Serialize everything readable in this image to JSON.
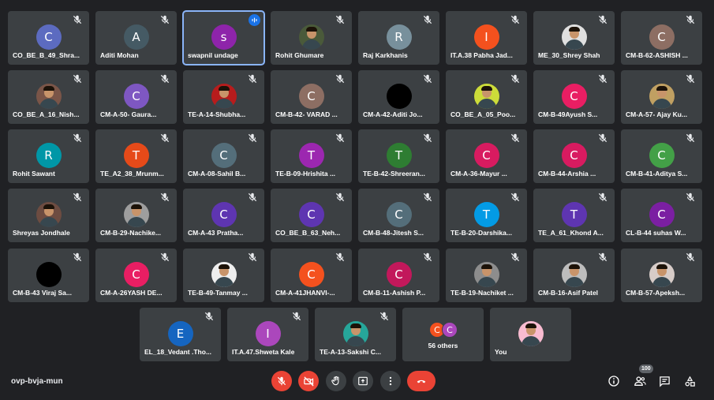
{
  "tiles": [
    {
      "name": "CO_BE_B_49_Shra...",
      "avatar": "C",
      "color": "#5c6bc0"
    },
    {
      "name": "Aditi Mohan",
      "avatar": "A",
      "color": "#455a64"
    },
    {
      "name": "swapnil undage",
      "avatar": "s",
      "color": "#8e24aa",
      "active": true
    },
    {
      "name": "Rohit Ghumare",
      "photo": true,
      "color": "#4a5a3a"
    },
    {
      "name": "Raj Karkhanis",
      "avatar": "R",
      "color": "#78909c"
    },
    {
      "name": "IT.A.38 Pabha Jad...",
      "avatar": "I",
      "color": "#f4511e"
    },
    {
      "name": "ME_30_Shrey Shah",
      "photo": true,
      "color": "#e0e0e0"
    },
    {
      "name": "CM-B-62-ASHISH ...",
      "avatar": "C",
      "color": "#8d6e63"
    },
    {
      "name": "CO_BE_A_16_Nish...",
      "photo": true,
      "color": "#7a5548"
    },
    {
      "name": "CM-A-50- Gaura...",
      "avatar": "C",
      "color": "#7e57c2"
    },
    {
      "name": "TE-A-14-Shubha...",
      "photo": true,
      "color": "#b71c1c"
    },
    {
      "name": "CM-B-42- VARAD ...",
      "avatar": "C",
      "color": "#8d6e63"
    },
    {
      "name": "CM-A-42-Aditi Jo...",
      "avatar": "",
      "color": "#000000"
    },
    {
      "name": "CO_BE_A_05_Poo...",
      "photo": true,
      "color": "#cddc39"
    },
    {
      "name": "CM-B-49Ayush S...",
      "avatar": "C",
      "color": "#e91e63"
    },
    {
      "name": "CM-A-57- Ajay Ku...",
      "photo": true,
      "color": "#c0a062"
    },
    {
      "name": "Rohit Sawant",
      "avatar": "R",
      "color": "#0097a7"
    },
    {
      "name": "TE_A2_38_Mrunm...",
      "avatar": "T",
      "color": "#e64a19"
    },
    {
      "name": "CM-A-08-Sahil B...",
      "avatar": "C",
      "color": "#546e7a"
    },
    {
      "name": "TE-B-09-Hrishita ...",
      "avatar": "T",
      "color": "#9c27b0"
    },
    {
      "name": "TE-B-42-Shreeran...",
      "avatar": "T",
      "color": "#2e7d32"
    },
    {
      "name": "CM-A-36-Mayur ...",
      "avatar": "C",
      "color": "#d81b60"
    },
    {
      "name": "CM-B-44-Arshia ...",
      "avatar": "C",
      "color": "#d81b60"
    },
    {
      "name": "CM-B-41-Aditya S...",
      "avatar": "C",
      "color": "#43a047"
    },
    {
      "name": "Shreyas Jondhale",
      "photo": true,
      "color": "#6d4c41"
    },
    {
      "name": "CM-B-29-Nachike...",
      "photo": true,
      "color": "#9e9e9e"
    },
    {
      "name": "CM-A-43 Pratha...",
      "avatar": "C",
      "color": "#5e35b1"
    },
    {
      "name": "CO_BE_B_63_Neh...",
      "avatar": "C",
      "color": "#5e35b1"
    },
    {
      "name": "CM-B-48-Jitesh S...",
      "avatar": "C",
      "color": "#546e7a"
    },
    {
      "name": "TE-B-20-Darshika...",
      "avatar": "T",
      "color": "#039be5"
    },
    {
      "name": "TE_A_61_Khond A...",
      "avatar": "T",
      "color": "#5e35b1"
    },
    {
      "name": "CL-B-44 suhas W...",
      "avatar": "C",
      "color": "#7b1fa2"
    },
    {
      "name": "CM-B-43 Viraj Sa...",
      "avatar": "",
      "color": "#000000"
    },
    {
      "name": "CM-A-26YASH DE...",
      "avatar": "C",
      "color": "#e91e63"
    },
    {
      "name": "TE-B-49-Tanmay ...",
      "photo": true,
      "color": "#eeeeee"
    },
    {
      "name": "CM-A-41JHANVI-...",
      "avatar": "C",
      "color": "#f4511e"
    },
    {
      "name": "CM-B-11-Ashish P...",
      "avatar": "C",
      "color": "#c2185b"
    },
    {
      "name": "TE-B-19-Nachiket ...",
      "photo": true,
      "color": "#8d8d8d"
    },
    {
      "name": "CM-B-16-Asif Patel",
      "photo": true,
      "color": "#bdbdbd"
    },
    {
      "name": "CM-B-57-Apeksh...",
      "photo": true,
      "color": "#d7ccc8"
    },
    {
      "name": "EL_18_Vedant .Tho...",
      "avatar": "E",
      "color": "#1565c0"
    },
    {
      "name": "IT.A.47.Shweta Kale",
      "avatar": "I",
      "color": "#ab47bc"
    },
    {
      "name": "TE-A-13-Sakshi C...",
      "photo": true,
      "color": "#26a69a"
    },
    {
      "others": true,
      "name": "56 others"
    },
    {
      "name": "You",
      "photo": true,
      "color": "#f8bbd0",
      "self": true
    }
  ],
  "others_avatars": [
    {
      "letter": "C",
      "color": "#f4511e"
    },
    {
      "letter": "C",
      "color": "#ab47bc"
    }
  ],
  "meeting_code": "ovp-bvja-mun",
  "participant_count": "100"
}
